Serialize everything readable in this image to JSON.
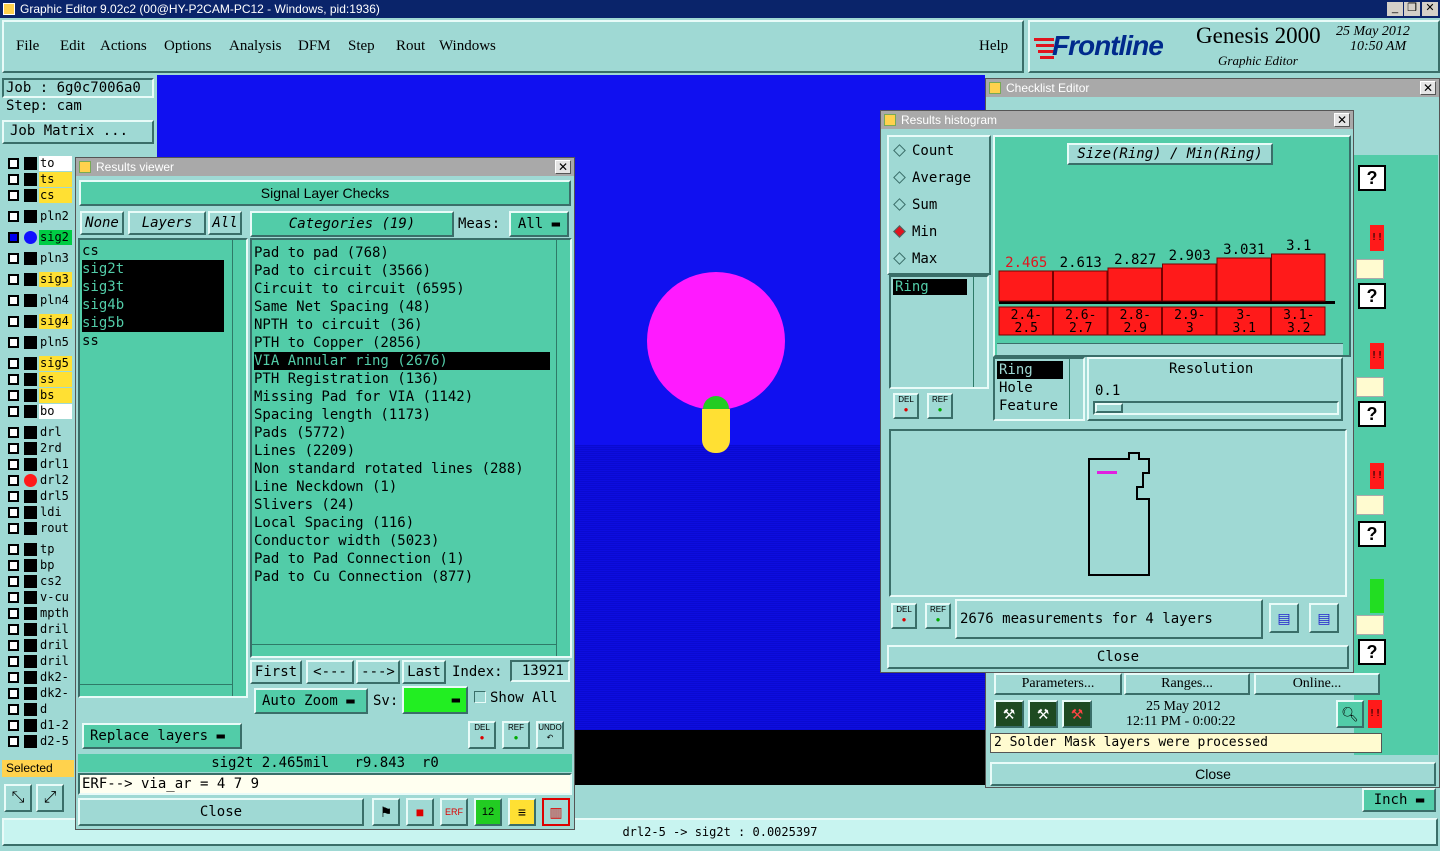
{
  "app": {
    "title": "Graphic Editor 9.02c2 (00@HY-P2CAM-PC12 - Windows, pid:1936)"
  },
  "menu": [
    "File",
    "Edit",
    "Actions",
    "Options",
    "Analysis",
    "DFM",
    "Step",
    "Rout",
    "Windows"
  ],
  "help": "Help",
  "brand": {
    "logo": "Frontline",
    "product": "Genesis 2000",
    "subtitle": "Graphic Editor",
    "date": "25 May 2012",
    "time": "10:50 AM"
  },
  "job": {
    "job_label": "Job : 6g0c7006a0",
    "step_label": "Step: cam",
    "matrix_button": "Job Matrix ..."
  },
  "layers": [
    "to",
    "ts",
    "cs",
    "pln2",
    "sig2",
    "pln3",
    "sig3",
    "pln4",
    "sig4",
    "pln5",
    "sig5",
    "ss",
    "bs",
    "bo",
    "drl",
    "2rd",
    "drl1",
    "drl2",
    "drl5",
    "ldi",
    "rout",
    "tp",
    "bp",
    "cs2",
    "v-cu",
    "mpth",
    "dril",
    "dril",
    "dril",
    "dk2-",
    "dk2-",
    "d",
    "d1-2",
    "d2-5"
  ],
  "selected_label": "Selected",
  "status_bar": "drl2-5 -> sig2t : 0.0025397",
  "results_viewer": {
    "title": "Results viewer",
    "header": "Signal Layer Checks",
    "none_btn": "None",
    "layers_btn": "Layers",
    "all_btn": "All",
    "layer_list": [
      "cs",
      "sig2t",
      "sig3t",
      "sig4b",
      "sig5b",
      "ss"
    ],
    "categories_label": "Categories (19)",
    "meas_label": "Meas:",
    "meas_value": "All",
    "categories": [
      "Pad to pad (768)",
      "Pad to circuit (3566)",
      "Circuit to circuit (6595)",
      "Same Net Spacing (48)",
      "NPTH to circuit (36)",
      "PTH to Copper (2856)",
      "VIA Annular ring (2676)",
      "PTH Registration (136)",
      "Missing Pad for VIA (1142)",
      "Spacing length (1173)",
      "Pads (5772)",
      "Lines (2209)",
      "Non standard rotated lines (288)",
      "Line Neckdown (1)",
      "Slivers (24)",
      "Local Spacing (116)",
      "Conductor width (5023)",
      "Pad to Pad Connection (1)",
      "Pad to Cu Connection (877)"
    ],
    "first": "First",
    "prev": "<---",
    "next": "--->",
    "last": "Last",
    "index_label": "Index:",
    "index_value": "13921",
    "auto_zoom": "Auto Zoom",
    "sv_label": "Sv:",
    "show_all": "Show All",
    "replace_layers": "Replace layers",
    "del": "DEL",
    "ref": "REF",
    "undo": "UNDO",
    "info": "sig2t 2.465mil   r9.843  r0",
    "erf": "ERF--> via_ar = 4 7 9",
    "close": "Close"
  },
  "histogram": {
    "title": "Results histogram",
    "options": [
      "Count",
      "Average",
      "Sum",
      "Min",
      "Max"
    ],
    "selected_option": "Min",
    "axis_title": "Size(Ring) / Min(Ring)",
    "measure_list": [
      "Ring"
    ],
    "type_list": [
      "Ring",
      "Hole",
      "Feature"
    ],
    "resolution_label": "Resolution",
    "resolution_value": "0.1",
    "measurements": "2676 measurements for 4 layers",
    "del": "DEL",
    "ref": "REF",
    "close": "Close"
  },
  "chart_data": {
    "type": "bar",
    "categories": [
      "2.4-2.5",
      "2.6-2.7",
      "2.8-2.9",
      "2.9-3",
      "3-3.1",
      "3.1-3.2"
    ],
    "category_lines": [
      [
        "2.4-",
        "2.5"
      ],
      [
        "2.6-",
        "2.7"
      ],
      [
        "2.8-",
        "2.9"
      ],
      [
        "2.9-",
        "3"
      ],
      [
        "3-",
        "3.1"
      ],
      [
        "3.1-",
        "3.2"
      ]
    ],
    "values": [
      2.465,
      2.613,
      2.827,
      2.903,
      3.031,
      3.1
    ],
    "value_labels": [
      "2.465",
      "2.613",
      "2.827",
      "2.903",
      "3.031",
      "3.1"
    ],
    "highlight_index": 0,
    "ylim": [
      0,
      3.2
    ],
    "bar_color": "#ff1a1a"
  },
  "checklist": {
    "title": "Checklist Editor",
    "parameters": "Parameters...",
    "ranges": "Ranges...",
    "online": "Online...",
    "date": "25 May 2012",
    "time": "12:11 PM - 0:00:22",
    "message": "2 Solder Mask layers were processed",
    "close": "Close"
  },
  "units": "Inch",
  "colors": {
    "canvas_blue": "#1010f0",
    "pad_magenta": "#ff1aff",
    "accent_red": "#ff1a1a",
    "panel_green": "#52cca8",
    "panel_teal": "#9fd9d4"
  }
}
